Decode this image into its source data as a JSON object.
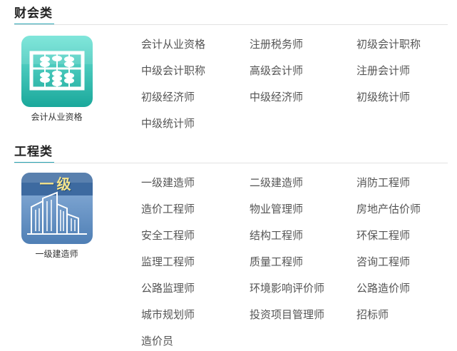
{
  "sections": [
    {
      "title": "财会类",
      "feature": {
        "label": "会计从业资格",
        "icon": "abacus-icon",
        "color": "#2fc6b8"
      },
      "links": [
        "会计从业资格",
        "注册税务师",
        "初级会计职称",
        "中级会计职称",
        "高级会计师",
        "注册会计师",
        "初级经济师",
        "中级经济师",
        "初级统计师",
        "中级统计师"
      ]
    },
    {
      "title": "工程类",
      "feature": {
        "label": "一级建造师",
        "icon": "buildings-icon",
        "badge": "一级",
        "color": "#6b94c3"
      },
      "links": [
        "一级建造师",
        "二级建造师",
        "消防工程师",
        "造价工程师",
        "物业管理师",
        "房地产估价师",
        "安全工程师",
        "结构工程师",
        "环保工程师",
        "监理工程师",
        "质量工程师",
        "咨询工程师",
        "公路监理师",
        "环境影响评价师",
        "公路造价师",
        "城市规划师",
        "投资项目管理师",
        "招标师",
        "造价员"
      ]
    }
  ],
  "colors": {
    "accent": "#2aa7b5",
    "link": "#555555",
    "title": "#222222"
  }
}
